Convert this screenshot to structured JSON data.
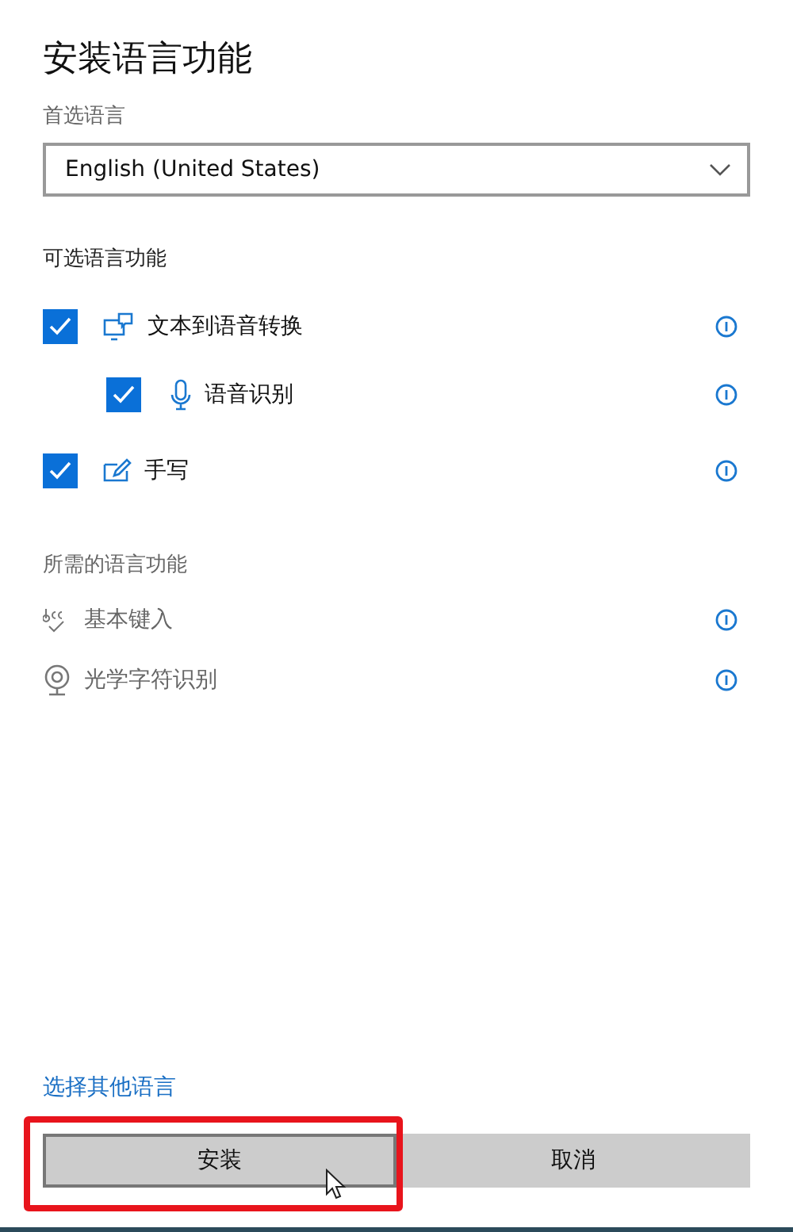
{
  "title": "安装语言功能",
  "preferred_language": {
    "label": "首选语言",
    "value": "English (United States)"
  },
  "optional_features": {
    "heading": "可选语言功能",
    "items": [
      {
        "label": "文本到语音转换",
        "checked": true,
        "children": [
          {
            "label": "语音识别",
            "checked": true
          }
        ]
      },
      {
        "label": "手写",
        "checked": true
      }
    ]
  },
  "required_features": {
    "heading": "所需的语言功能",
    "items": [
      {
        "label": "基本键入"
      },
      {
        "label": "光学字符识别"
      }
    ]
  },
  "link": "选择其他语言",
  "buttons": [
    {
      "label": "安装",
      "highlighted": true
    },
    {
      "label": "取消",
      "highlighted": false
    }
  ]
}
